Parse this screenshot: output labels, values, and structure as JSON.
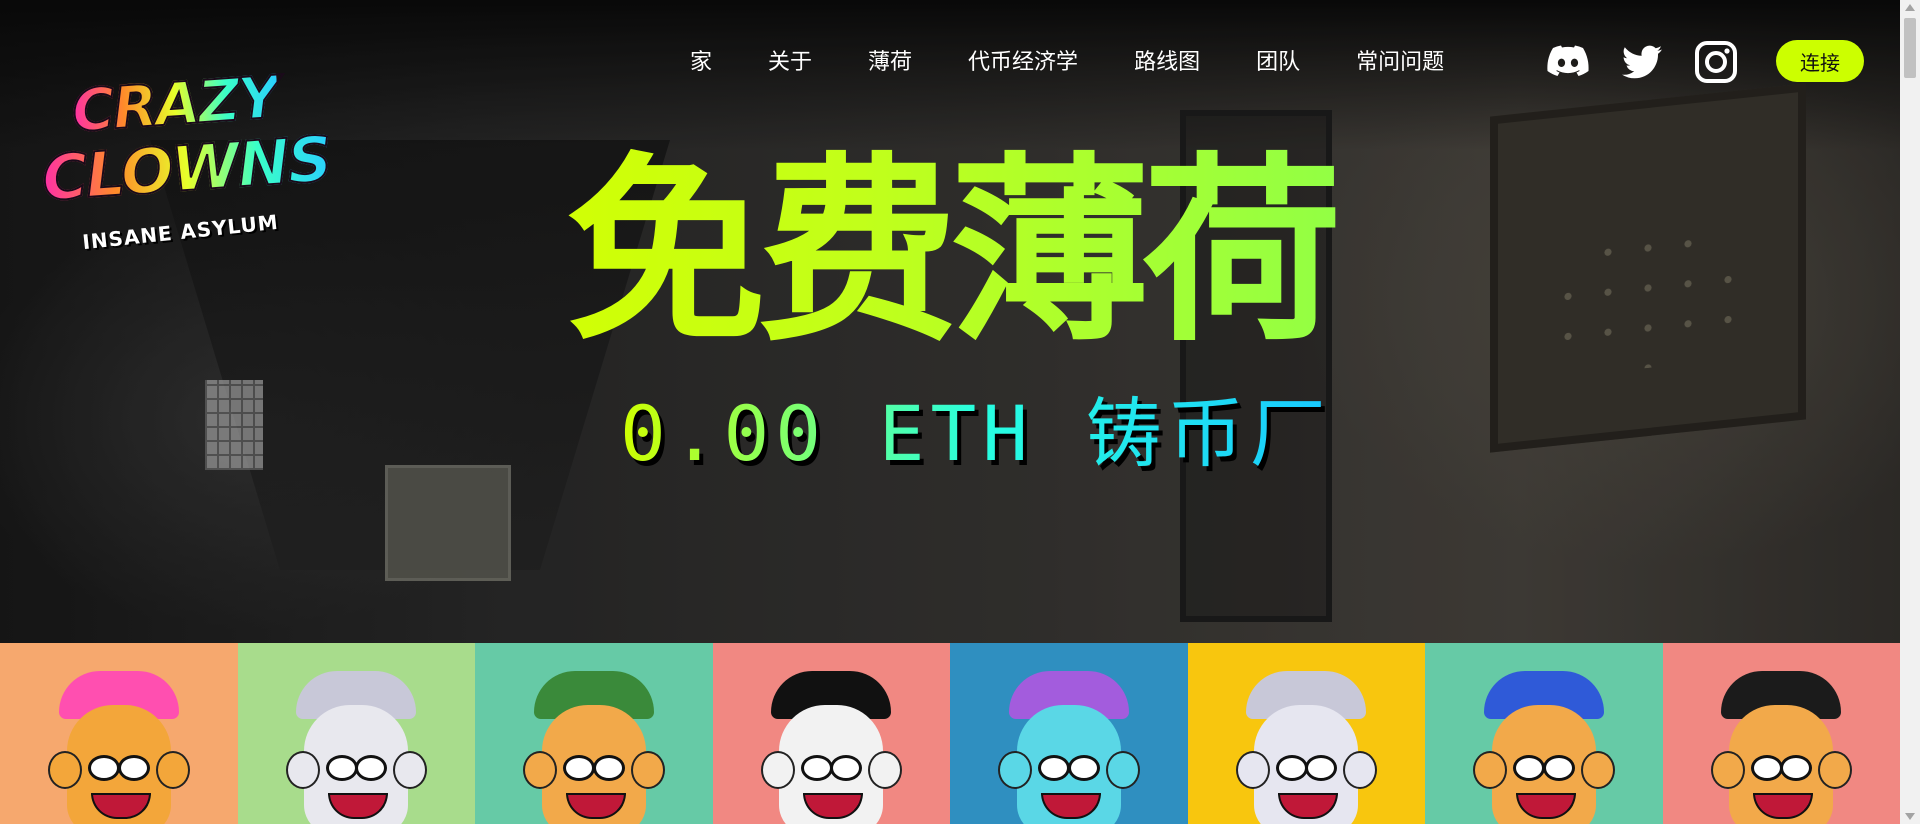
{
  "logo": {
    "line1": "CRAZY",
    "line2": "CLOWNS",
    "line3": "INSANE ASYLUM"
  },
  "nav": {
    "items": [
      {
        "label": "家"
      },
      {
        "label": "关于"
      },
      {
        "label": "薄荷"
      },
      {
        "label": "代币经济学"
      },
      {
        "label": "路线图"
      },
      {
        "label": "团队"
      },
      {
        "label": "常问问题"
      }
    ]
  },
  "social": {
    "icons": [
      "discord-icon",
      "twitter-icon",
      "instagram-icon"
    ]
  },
  "connect_button": {
    "label": "连接",
    "color": "#ccff00"
  },
  "hero": {
    "headline": "免费薄荷",
    "subline": "0.00 ETH 铸币厂"
  },
  "gallery": {
    "tiles": [
      {
        "bg": "#f6a86e",
        "face": "#f3a63a",
        "hat": "#ff4fb0"
      },
      {
        "bg": "#a8dc8c",
        "face": "#e8e8ee",
        "hat": "#c8c8d8"
      },
      {
        "bg": "#66caa6",
        "face": "#f2a94a",
        "hat": "#3a8a3a"
      },
      {
        "bg": "#f18882",
        "face": "#f2f2f2",
        "hat": "#111111"
      },
      {
        "bg": "#2f8fc0",
        "face": "#5ad7e6",
        "hat": "#a35cdd"
      },
      {
        "bg": "#f8c60e",
        "face": "#e6e6f0",
        "hat": "#c8c8d8"
      },
      {
        "bg": "#66caa6",
        "face": "#f2a94a",
        "hat": "#2f5ad8"
      },
      {
        "bg": "#f18882",
        "face": "#f2a94a",
        "hat": "#1b1b1b"
      }
    ]
  }
}
